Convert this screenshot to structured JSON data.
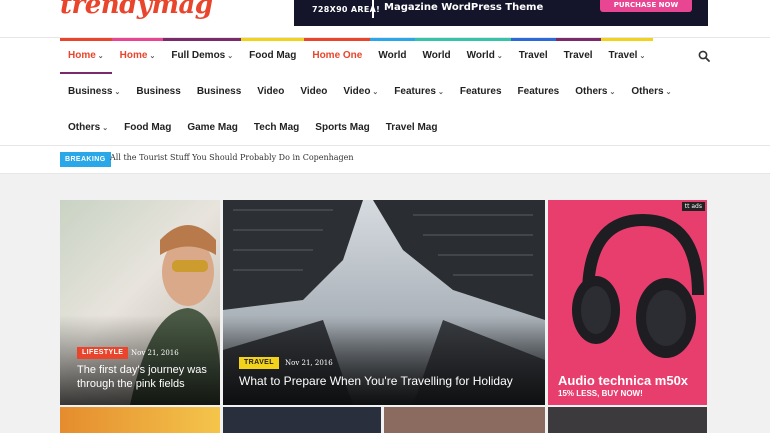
{
  "header": {
    "logo_text": "trendymag",
    "ad": {
      "size_label": "728X90 AREA!",
      "text": "Magazine WordPress Theme",
      "button_label": "PURCHASE NOW"
    }
  },
  "nav": {
    "row1": [
      {
        "label": "Home",
        "dropdown": true,
        "active": true,
        "bar": "#e8452c"
      },
      {
        "label": "Home",
        "dropdown": true,
        "active": true,
        "bar": "#e84593"
      },
      {
        "label": "Full Demos",
        "dropdown": true,
        "active": false,
        "bar": "#7a2a6a"
      },
      {
        "label": "Food Mag",
        "dropdown": false,
        "active": false,
        "bar": "#f3d21b"
      },
      {
        "label": "Home One",
        "dropdown": false,
        "active": true,
        "bar": "#e8452c"
      },
      {
        "label": "World",
        "dropdown": false,
        "active": false,
        "bar": "#2aa7e8"
      },
      {
        "label": "World",
        "dropdown": false,
        "active": false,
        "bar": "#35c4a8"
      },
      {
        "label": "World",
        "dropdown": true,
        "active": false,
        "bar": "#35c4a8"
      },
      {
        "label": "Travel",
        "dropdown": false,
        "active": false,
        "bar": "#2a6ad8"
      },
      {
        "label": "Travel",
        "dropdown": false,
        "active": false,
        "bar": "#7a2a6a"
      },
      {
        "label": "Travel",
        "dropdown": true,
        "active": false,
        "bar": "#f3d21b"
      }
    ],
    "row2": [
      {
        "label": "Business",
        "dropdown": true
      },
      {
        "label": "Business",
        "dropdown": false
      },
      {
        "label": "Business",
        "dropdown": false
      },
      {
        "label": "Video",
        "dropdown": false
      },
      {
        "label": "Video",
        "dropdown": false
      },
      {
        "label": "Video",
        "dropdown": true
      },
      {
        "label": "Features",
        "dropdown": true
      },
      {
        "label": "Features",
        "dropdown": false
      },
      {
        "label": "Features",
        "dropdown": false
      },
      {
        "label": "Others",
        "dropdown": true
      },
      {
        "label": "Others",
        "dropdown": true
      }
    ],
    "row3": [
      {
        "label": "Others",
        "dropdown": true
      },
      {
        "label": "Food Mag",
        "dropdown": false
      },
      {
        "label": "Game Mag",
        "dropdown": false
      },
      {
        "label": "Tech Mag",
        "dropdown": false
      },
      {
        "label": "Sports Mag",
        "dropdown": false
      },
      {
        "label": "Travel Mag",
        "dropdown": false
      }
    ],
    "search_icon": "search-icon"
  },
  "breaking": {
    "badge": "BREAKING",
    "text": "All the Tourist Stuff You Should Probably Do in Copenhagen"
  },
  "featured": {
    "card1": {
      "tag": "LIFESTYLE",
      "date": "Nov 21, 2016",
      "headline": "The first day's journey was through the pink fields"
    },
    "card2": {
      "tag": "TRAVEL",
      "date": "Nov 21, 2016",
      "headline": "What to Prepare When You're Travelling for Holiday"
    },
    "ad": {
      "label": "tt ads",
      "title": "Audio technica m50x",
      "subtitle": "15% LESS, BUY NOW!"
    }
  },
  "colors": {
    "accent": "#e8452c",
    "breaking": "#2aa7e8",
    "ad_pink": "#e83e6e"
  }
}
